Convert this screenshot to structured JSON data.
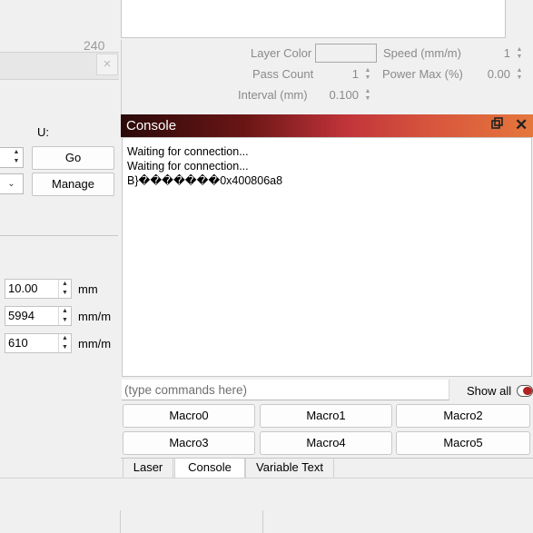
{
  "left_panel": {
    "ghost_number": "240",
    "close_glyph": "×",
    "u_label": "U:",
    "go_label": "Go",
    "manage_label": "Manage",
    "fields": [
      {
        "value": "10.00",
        "unit": "mm"
      },
      {
        "value": "5994",
        "unit": "mm/m"
      },
      {
        "value": "610",
        "unit": "mm/m"
      }
    ]
  },
  "layer_settings": {
    "layer_color_label": "Layer Color",
    "speed_label": "Speed (mm/m)",
    "speed_value": "1",
    "pass_count_label": "Pass Count",
    "pass_count_value": "1",
    "power_max_label": "Power Max (%)",
    "power_max_value": "0.00",
    "interval_label": "Interval (mm)",
    "interval_value": "0.100"
  },
  "console": {
    "title": "Console",
    "lines": [
      "Waiting for connection...",
      "Waiting for connection...",
      "B}�������0x400806a8"
    ],
    "input_placeholder": "(type commands here)",
    "show_all_label": "Show all",
    "show_all_on": false,
    "macros": [
      "Macro0",
      "Macro1",
      "Macro2",
      "Macro3",
      "Macro4",
      "Macro5"
    ]
  },
  "tabs": {
    "laser": "Laser",
    "console": "Console",
    "variable_text": "Variable Text",
    "active": "Console"
  },
  "colors": {
    "accent_red": "#c2343a",
    "accent_orange": "#e5773c"
  }
}
